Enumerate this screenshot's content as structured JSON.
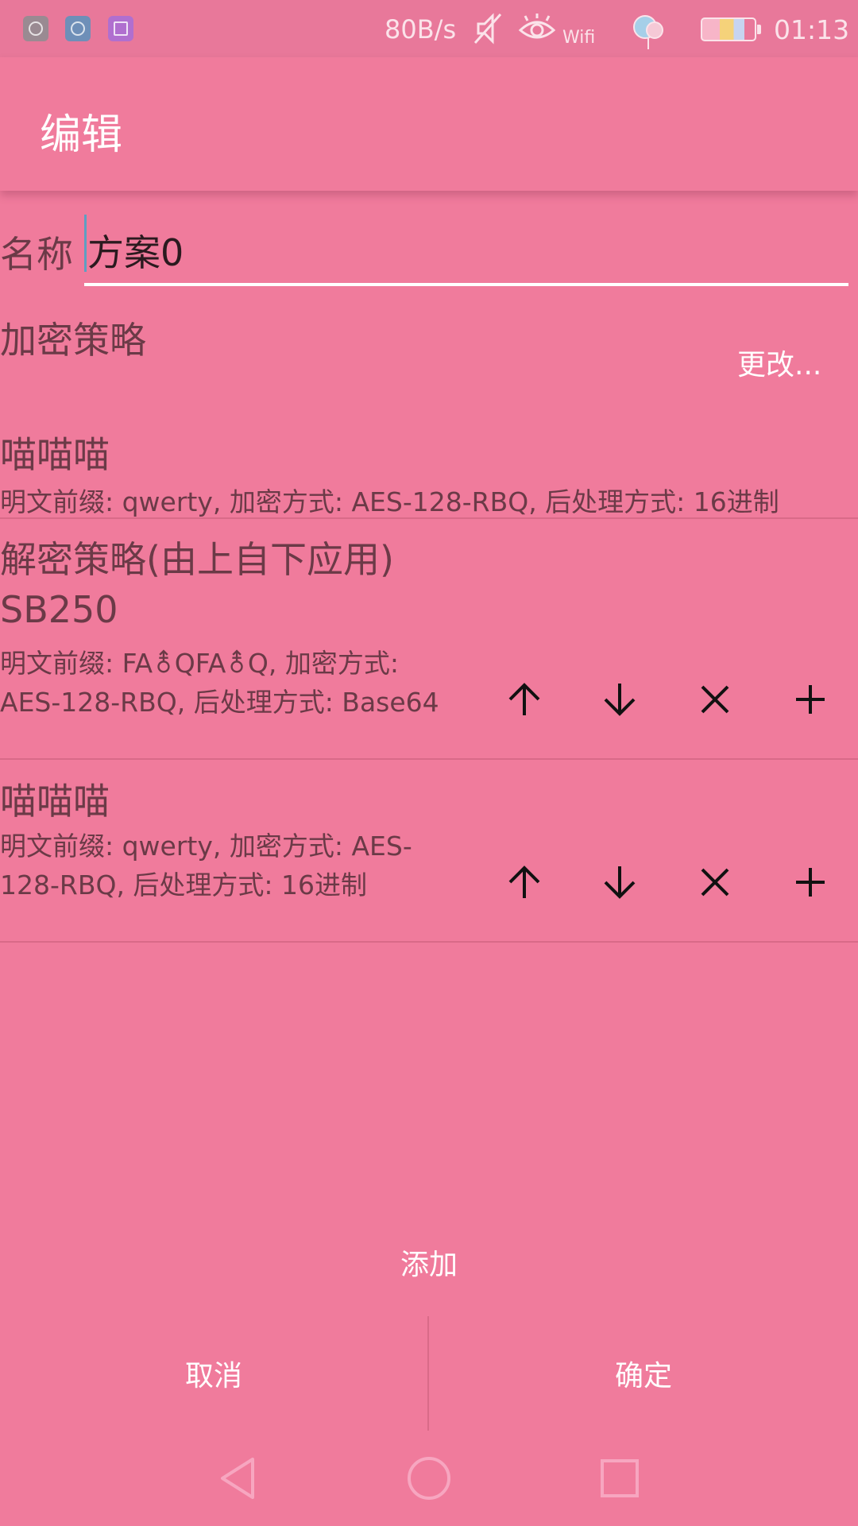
{
  "status_bar": {
    "network_speed": "80B/s",
    "wifi_label": "Wifi",
    "time": "01:13",
    "icons": [
      "app-icon-1",
      "app-icon-2",
      "gallery-icon",
      "mute-icon",
      "eye-icon",
      "wifi-icon",
      "balloon-icon",
      "battery-icon"
    ]
  },
  "toolbar": {
    "title": "编辑"
  },
  "form": {
    "name_label": "名称",
    "name_value": "方案0"
  },
  "encryption": {
    "heading": "加密策略",
    "change_label": "更改...",
    "strategy": {
      "name": "喵喵喵",
      "description": "明文前缀: qwerty, 加密方式: AES-128-RBQ, 后处理方式: 16进制"
    }
  },
  "decryption": {
    "heading": "解密策略(由上自下应用)",
    "items": [
      {
        "name": "SB250",
        "description": "明文前缀: FA⚨QFA⚨Q, 加密方式: AES-128-RBQ, 后处理方式: Base64"
      },
      {
        "name": "喵喵喵",
        "description": "明文前缀: qwerty, 加密方式: AES-128-RBQ, 后处理方式: 16进制"
      }
    ],
    "actions": [
      "arrow-up-icon",
      "arrow-down-icon",
      "close-icon",
      "plus-icon"
    ]
  },
  "buttons": {
    "add_label": "添加",
    "cancel_label": "取消",
    "ok_label": "确定"
  },
  "colors": {
    "background": "#f07b9c",
    "status_bar": "#e8789a",
    "accent_white": "#ffffff",
    "text": "#6b3a47",
    "cursor": "#5e9fc2"
  }
}
